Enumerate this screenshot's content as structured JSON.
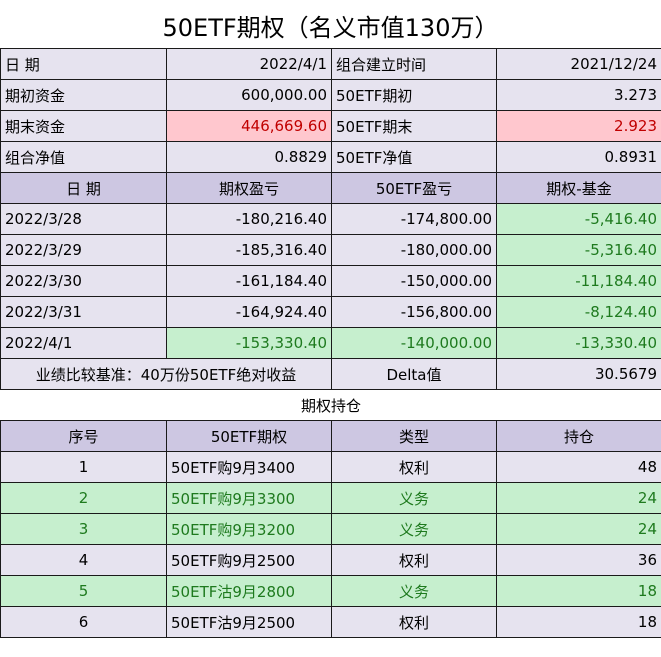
{
  "title": "50ETF期权（名义市值130万）",
  "summary": [
    {
      "label1": "日  期",
      "value1": "2022/4/1",
      "label2": "组合建立时间",
      "value2": "2021/12/24",
      "hl": false
    },
    {
      "label1": "期初资金",
      "value1": "600,000.00",
      "label2": "50ETF期初",
      "value2": "3.273",
      "hl": false
    },
    {
      "label1": "期末资金",
      "value1": "446,669.60",
      "label2": "50ETF期末",
      "value2": "2.923",
      "hl": true
    },
    {
      "label1": "组合净值",
      "value1": "0.8829",
      "label2": "50ETF净值",
      "value2": "0.8931",
      "hl": false
    }
  ],
  "pnl_headers": [
    "日  期",
    "期权盈亏",
    "50ETF盈亏",
    "期权-基金"
  ],
  "pnl_rows": [
    {
      "date": "2022/3/28",
      "option": "-180,216.40",
      "etf": "-174,800.00",
      "diff": "-5,416.40"
    },
    {
      "date": "2022/3/29",
      "option": "-185,316.40",
      "etf": "-180,000.00",
      "diff": "-5,316.40"
    },
    {
      "date": "2022/3/30",
      "option": "-161,184.40",
      "etf": "-150,000.00",
      "diff": "-11,184.40"
    },
    {
      "date": "2022/3/31",
      "option": "-164,924.40",
      "etf": "-156,800.00",
      "diff": "-8,124.40"
    },
    {
      "date": "2022/4/1",
      "option": "-153,330.40",
      "etf": "-140,000.00",
      "diff": "-13,330.40"
    }
  ],
  "benchmark_label": "业绩比较基准：40万份50ETF绝对收益",
  "delta_label": "Delta值",
  "delta_value": "30.5679",
  "positions_title": "期权持仓",
  "positions_headers": [
    "序号",
    "50ETF期权",
    "类型",
    "持仓"
  ],
  "positions": [
    {
      "no": "1",
      "name": "50ETF购9月3400",
      "type": "权利",
      "qty": "48",
      "short": false
    },
    {
      "no": "2",
      "name": "50ETF购9月3300",
      "type": "义务",
      "qty": "24",
      "short": true
    },
    {
      "no": "3",
      "name": "50ETF购9月3200",
      "type": "义务",
      "qty": "24",
      "short": true
    },
    {
      "no": "4",
      "name": "50ETF购9月2500",
      "type": "权利",
      "qty": "36",
      "short": false
    },
    {
      "no": "5",
      "name": "50ETF沽9月2800",
      "type": "义务",
      "qty": "18",
      "short": true
    },
    {
      "no": "6",
      "name": "50ETF沽9月2500",
      "type": "权利",
      "qty": "18",
      "short": false
    }
  ],
  "colors": {
    "header_purple": "#cdc7e2",
    "row_lavender": "#e6e3ef",
    "highlight_red_bg": "#ffc7ce",
    "highlight_red_text": "#c00000",
    "highlight_green_bg": "#c6efce",
    "highlight_green_text": "#1e7a1e"
  }
}
